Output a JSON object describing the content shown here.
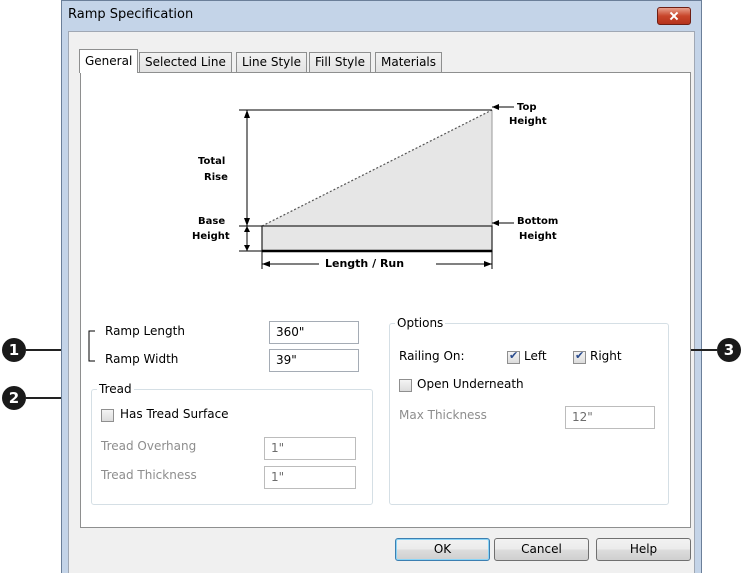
{
  "window": {
    "title": "Ramp Specification"
  },
  "tabs": [
    "General",
    "Selected Line",
    "Line Style",
    "Fill Style",
    "Materials"
  ],
  "diagram": {
    "top_height": [
      "Top",
      "Height"
    ],
    "total_rise": [
      "Total",
      "Rise"
    ],
    "base_height": [
      "Base",
      "Height"
    ],
    "bottom_height": [
      "Bottom",
      "Height"
    ],
    "length_run": "Length / Run"
  },
  "ramp": {
    "length_label": "Ramp Length",
    "length_value": "360\"",
    "width_label": "Ramp Width",
    "width_value": "39\""
  },
  "tread": {
    "group_title": "Tread",
    "has_tread_label": "Has Tread Surface",
    "has_tread_checked": false,
    "overhang_label": "Tread Overhang",
    "overhang_value": "1\"",
    "thickness_label": "Tread Thickness",
    "thickness_value": "1\""
  },
  "options": {
    "group_title": "Options",
    "railing_label": "Railing On:",
    "left_label": "Left",
    "left_checked": true,
    "right_label": "Right",
    "right_checked": true,
    "open_underneath_label": "Open Underneath",
    "open_underneath_checked": false,
    "max_thickness_label": "Max Thickness",
    "max_thickness_value": "12\""
  },
  "buttons": {
    "ok": "OK",
    "cancel": "Cancel",
    "help": "Help"
  },
  "callouts": [
    "1",
    "2",
    "3"
  ]
}
